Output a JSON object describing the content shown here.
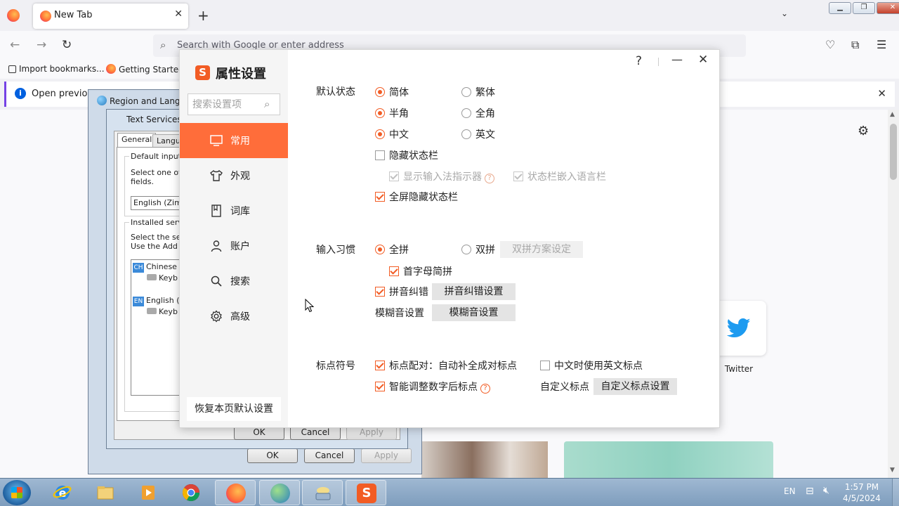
{
  "browser": {
    "tab_title": "New Tab",
    "tab_close": "✕",
    "new_tab": "+",
    "list_tabs": "⌄",
    "url_placeholder": "Search with Google or enter address",
    "bookmarks": [
      {
        "label": "Import bookmarks..."
      },
      {
        "label": "Getting Started"
      }
    ],
    "notification": "Open previous",
    "twitter_label": "Twitter",
    "window_buttons": {
      "min": "▁",
      "restore": "❐",
      "close": "✕"
    }
  },
  "region_dialog": {
    "title": "Region and Langua",
    "ok": "OK",
    "cancel": "Cancel",
    "apply": "Apply"
  },
  "text_services": {
    "title": "Text Services a",
    "tab_general": "General",
    "tab_language": "Langua",
    "default_input_label": "Default input la",
    "default_input_desc_1": "Select one of t",
    "default_input_desc_2": "fields.",
    "default_input_value": "English (Zimb",
    "installed_label": "Installed servic",
    "installed_desc_1": "Select the ser",
    "installed_desc_2": "Use the Add a",
    "tree": [
      {
        "flag": "CH",
        "label": "Chinese"
      },
      {
        "kb": "Keyb"
      },
      {
        "flag": "EN",
        "label": "English ("
      },
      {
        "kb": "Keyb"
      }
    ],
    "ok": "OK",
    "cancel": "Cancel",
    "apply": "Apply"
  },
  "sogou": {
    "logo": "S",
    "title": "属性设置",
    "search_placeholder": "搜索设置项",
    "nav": [
      {
        "label": "常用",
        "active": true
      },
      {
        "label": "外观"
      },
      {
        "label": "词库"
      },
      {
        "label": "账户"
      },
      {
        "label": "搜索"
      },
      {
        "label": "高级"
      }
    ],
    "restore_defaults": "恢复本页默认设置",
    "help": "?",
    "minimize": "—",
    "close": "✕",
    "default_state": {
      "label": "默认状态",
      "simplified": "简体",
      "traditional": "繁体",
      "half_width": "半角",
      "full_width": "全角",
      "chinese": "中文",
      "english": "英文",
      "hide_status_bar": "隐藏状态栏",
      "show_ime_indicator": "显示输入法指示器",
      "embed_language_bar": "状态栏嵌入语言栏",
      "fullscreen_hide_status_bar": "全屏隐藏状态栏"
    },
    "input_habit": {
      "label": "输入习惯",
      "full_pinyin": "全拼",
      "double_pinyin": "双拼",
      "double_scheme_btn": "双拼方案设定",
      "initial_abbrev": "首字母简拼",
      "pinyin_correction": "拼音纠错",
      "pinyin_correction_btn": "拼音纠错设置",
      "fuzzy_label": "模糊音设置",
      "fuzzy_btn": "模糊音设置"
    },
    "punctuation": {
      "label": "标点符号",
      "auto_pair": "标点配对：自动补全成对标点",
      "english_punct_in_chinese": "中文时使用英文标点",
      "smart_number_punct": "智能调整数字后标点",
      "custom_label": "自定义标点",
      "custom_btn": "自定义标点设置"
    }
  },
  "taskbar": {
    "lang": "EN",
    "time": "1:57 PM",
    "date": "4/5/2024"
  },
  "colors": {
    "accent": "#ff6d3a",
    "accent_check": "#f25c24",
    "twitter": "#1d9bf0"
  }
}
